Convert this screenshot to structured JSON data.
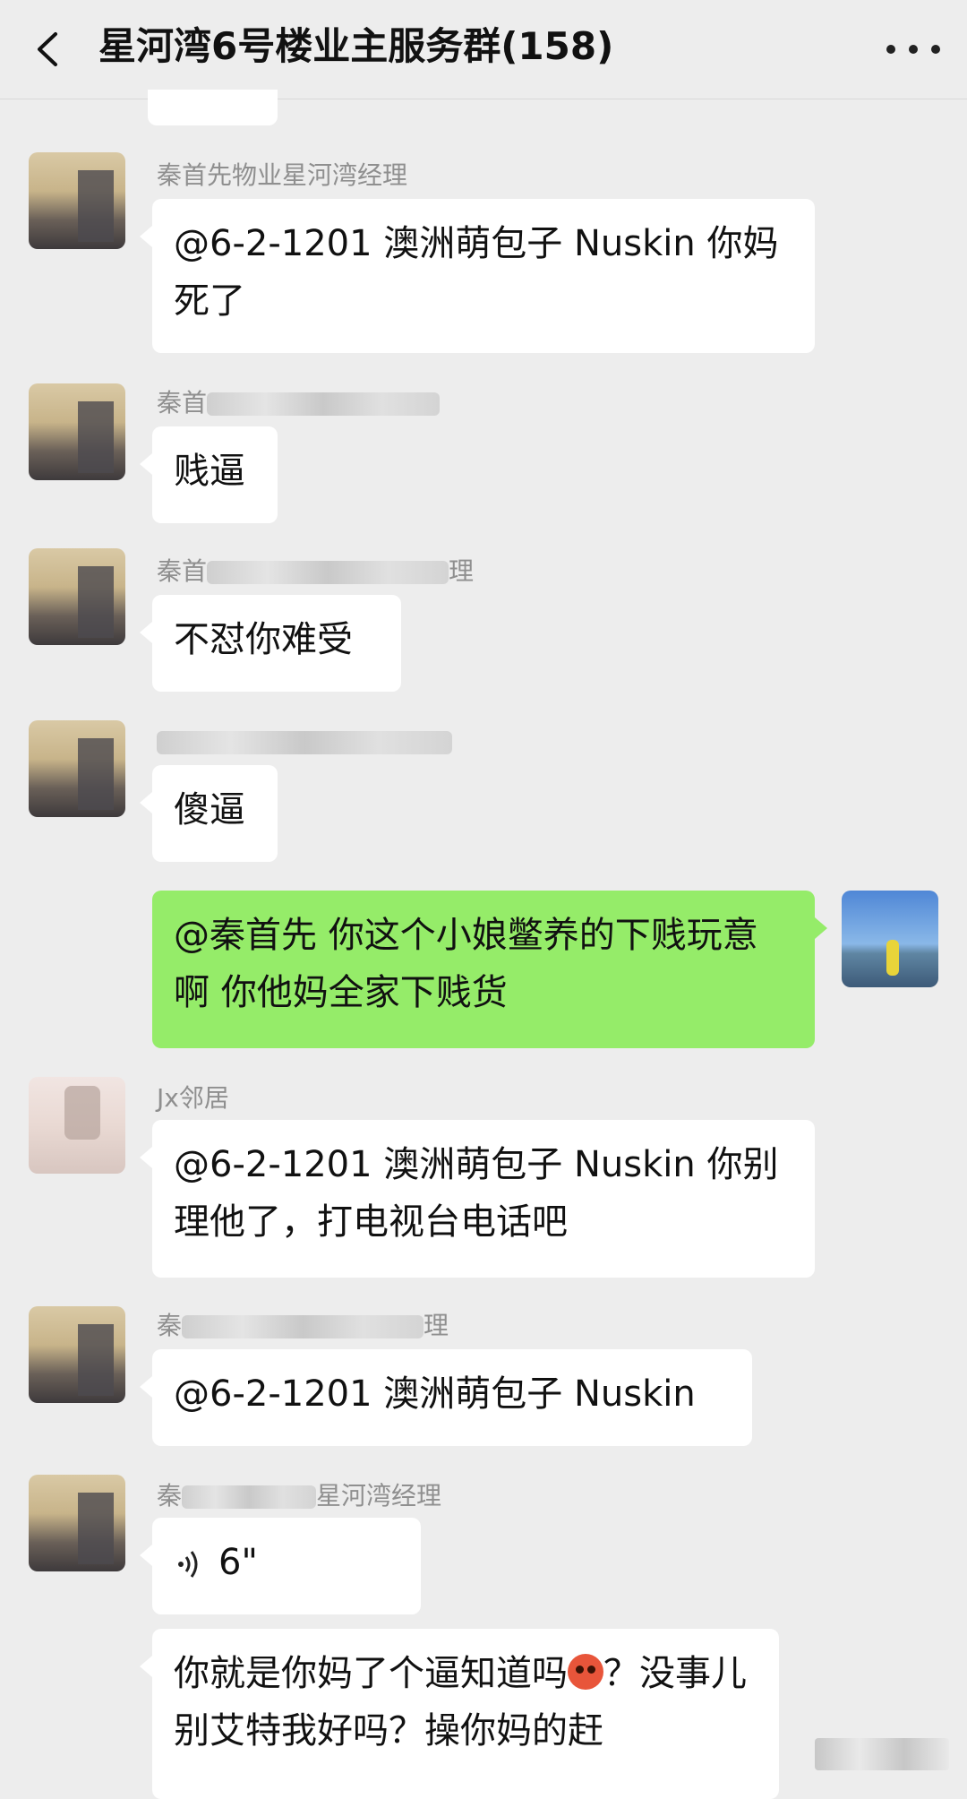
{
  "header": {
    "title": "星河湾6号楼业主服务群(158)",
    "back_icon": "chevron-left-icon",
    "more_icon": "more-dots-icon"
  },
  "messages": [
    {
      "sender": "秦首先物业星河湾经理",
      "text": "@6-2-1201 澳洲萌包子 Nuskin  你妈死了"
    },
    {
      "sender": "秦首",
      "text": "贱逼"
    },
    {
      "sender": "秦首",
      "sender_tail": "理",
      "text": "不怼你难受"
    },
    {
      "sender": "",
      "text": "傻逼"
    },
    {
      "sender": "",
      "text": "@秦首先  你这个小娘鳖养的下贱玩意啊 你他妈全家下贱货",
      "self": true
    },
    {
      "sender": "Jx邻居",
      "text": "@6-2-1201 澳洲萌包子 Nuskin  你别理他了，打电视台电话吧"
    },
    {
      "sender": "秦",
      "sender_tail": "理",
      "text": "@6-2-1201 澳洲萌包子 Nuskin"
    },
    {
      "sender": "秦",
      "sender_tail": "星河湾经理",
      "voice": "6\""
    },
    {
      "sender": "",
      "text_a": "你就是你妈了个逼知道吗",
      "text_b": "？没事儿别艾特我好吗？操你妈的赶"
    }
  ],
  "colors": {
    "background": "#ededed",
    "bubble_left": "#ffffff",
    "bubble_right": "#95ec69"
  }
}
